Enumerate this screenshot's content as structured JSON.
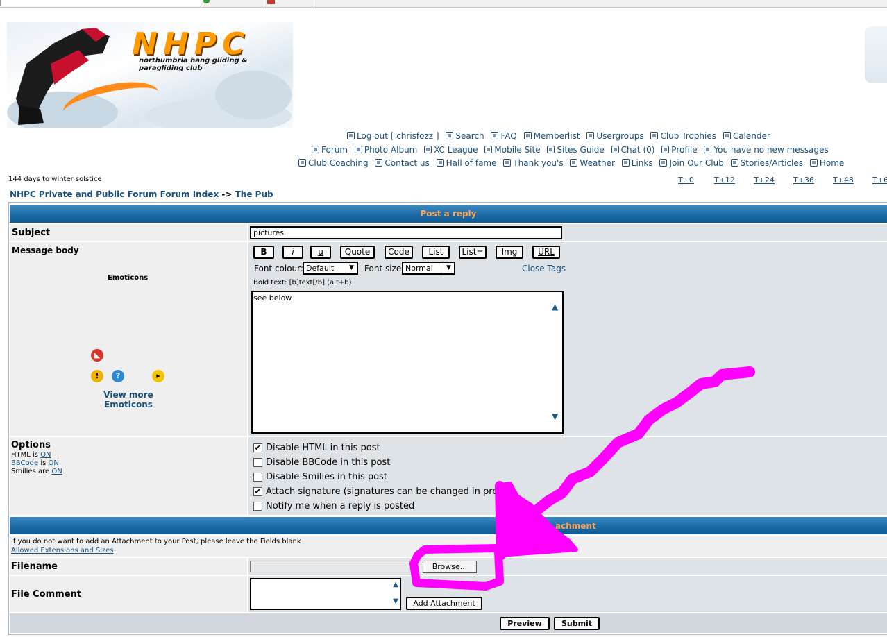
{
  "site": {
    "logo_text": "NHPC",
    "logo_tagline": "northumbria hang gliding & paragliding club"
  },
  "nav": {
    "row1": [
      "Log out [ chrisfozz ]",
      "Search",
      "FAQ",
      "Memberlist",
      "Usergroups",
      "Club Trophies",
      "Calender"
    ],
    "row2": [
      "Forum",
      "Photo Album",
      "XC League",
      "Mobile Site",
      "Sites Guide",
      "Chat (0)",
      "Profile",
      "You have no new messages"
    ],
    "row3": [
      "Club Coaching",
      "Contact us",
      "Hall of fame",
      "Thank you's",
      "Weather",
      "Links",
      "Join Our Club",
      "Stories/Articles",
      "Home"
    ]
  },
  "solstice": "144 days to winter solstice",
  "time_links": [
    "T+0",
    "T+12",
    "T+24",
    "T+36",
    "T+48",
    "T+6"
  ],
  "breadcrumb": {
    "index": "NHPC Private and Public Forum Forum Index",
    "arrow": "->",
    "current": "The Pub"
  },
  "post_reply": {
    "header": "Post a reply",
    "subject_label": "Subject",
    "subject_value": "pictures",
    "message_label": "Message body",
    "emoticons_label": "Emoticons",
    "view_more": "View more",
    "view_more_2": "Emoticons",
    "bb_buttons": [
      "B",
      "i",
      "u",
      "Quote",
      "Code",
      "List",
      "List=",
      "Img",
      "URL"
    ],
    "font_colour_label": "Font colour:",
    "font_colour_value": "Default",
    "font_size_label": "Font size:",
    "font_size_value": "Normal",
    "close_tags": "Close Tags",
    "help_text": "Bold text: [b]text[/b]  (alt+b)",
    "message_value": "see below"
  },
  "options": {
    "label": "Options",
    "html_line": "HTML is",
    "html_state": "ON",
    "bbcode_link": "BBCode",
    "bbcode_is": "is",
    "bbcode_state": "ON",
    "smilies_line": "Smilies are",
    "smilies_state": "ON",
    "items": [
      {
        "label": "Disable HTML in this post",
        "checked": true
      },
      {
        "label": "Disable BBCode in this post",
        "checked": false
      },
      {
        "label": "Disable Smilies in this post",
        "checked": false
      },
      {
        "label": "Attach signature (signatures can be changed in profile",
        "checked": true
      },
      {
        "label": "Notify me when a reply is posted",
        "checked": false
      }
    ]
  },
  "attachment": {
    "header_partial": "achment",
    "info": "If you do not want to add an Attachment to your Post, please leave the Fields blank",
    "allowed_link": "Allowed Extensions and Sizes",
    "filename_label": "Filename",
    "browse": "Browse...",
    "comment_label": "File Comment",
    "add_attachment": "Add Attachment"
  },
  "actions": {
    "preview": "Preview",
    "submit": "Submit"
  },
  "colors": {
    "header_bg": "#1b6aa5",
    "header_text": "#ffa34f",
    "link": "#1a4f7a",
    "annotation": "#ff00ff"
  }
}
